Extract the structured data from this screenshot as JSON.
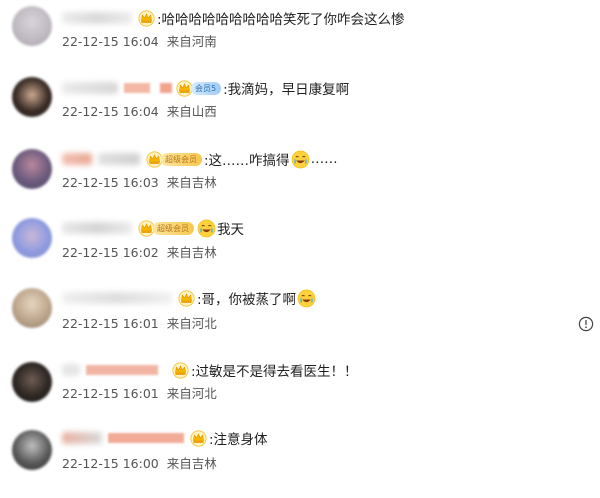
{
  "comments": [
    {
      "text": ":哈哈哈哈哈哈哈哈哈笑死了你咋会这么惨",
      "time": "22-12-15 16:04",
      "location": "来自河南"
    },
    {
      "text": ":我滴妈，早日康复啊",
      "badge": "会员5",
      "time": "22-12-15 16:04",
      "location": "来自山西"
    },
    {
      "text_before": ":这……咋搞得",
      "text_after": "……",
      "badge": "超级会员",
      "time": "22-12-15 16:03",
      "location": "来自吉林"
    },
    {
      "text": "我天",
      "badge": "超级会员",
      "time": "22-12-15 16:02",
      "location": "来自吉林"
    },
    {
      "text": ":哥，你被蒸了啊",
      "time": "22-12-15 16:01",
      "location": "来自河北"
    },
    {
      "text": ":过敏是不是得去看医生！！",
      "time": "22-12-15 16:01",
      "location": "来自河北"
    },
    {
      "text": ":注意身体",
      "time": "22-12-15 16:00",
      "location": "来自吉林"
    }
  ],
  "icons": {
    "crown": "vip-crown-icon",
    "emoji": "crying-laughing-emoji-icon",
    "report": "exclamation-circle-icon"
  },
  "colors": {
    "text": "#1f1f1f",
    "meta": "#555555",
    "crown": "#f5b400",
    "badge_gold": "#f7c74d",
    "badge_blue": "#9fcaf6"
  }
}
